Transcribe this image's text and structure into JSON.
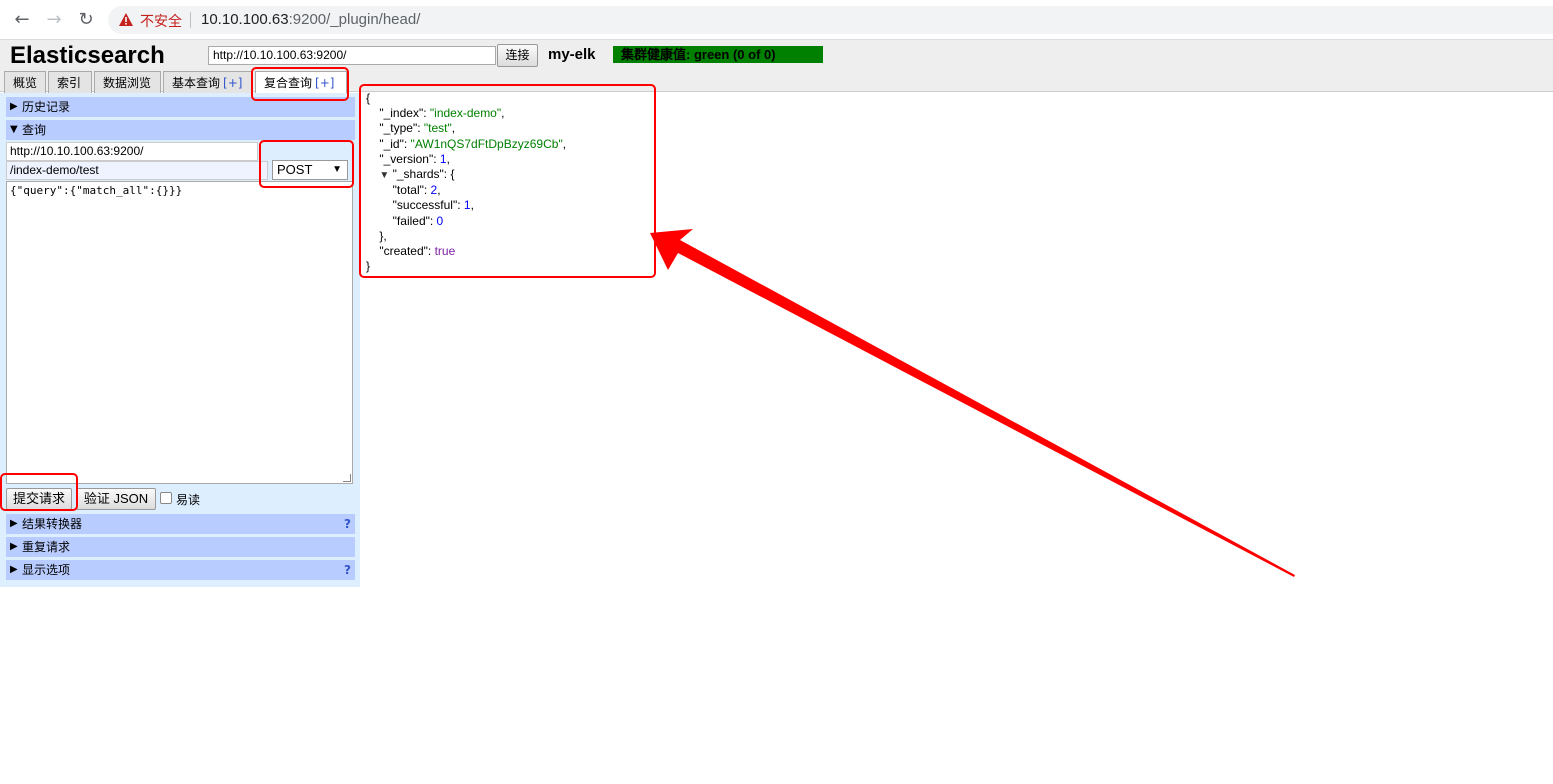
{
  "browser": {
    "security_label": "不安全",
    "url_host": "10.10.100.63",
    "url_rest": ":9200/_plugin/head/"
  },
  "app": {
    "title": "Elasticsearch",
    "connect_url": "http://10.10.100.63:9200/",
    "connect_button": "连接",
    "cluster_name": "my-elk",
    "health_text": "集群健康值: green (0 of 0)",
    "health_color": "#008000"
  },
  "tabs": [
    {
      "label": "概览",
      "plus": ""
    },
    {
      "label": "索引",
      "plus": ""
    },
    {
      "label": "数据浏览",
      "plus": ""
    },
    {
      "label": "基本查询",
      "plus": "[+]"
    },
    {
      "label": "复合查询",
      "plus": "[+]"
    }
  ],
  "left": {
    "history": "历史记录",
    "query": "查询",
    "base_url": "http://10.10.100.63:9200/",
    "path": "/index-demo/test",
    "method": "POST",
    "body": "{\"query\":{\"match_all\":{}}}",
    "submit": "提交请求",
    "validate": "验证 JSON",
    "pretty_label": "易读",
    "transformer": "结果转换器",
    "repeat": "重复请求",
    "display": "显示选项",
    "help": "?"
  },
  "result": {
    "_index": "index-demo",
    "_type": "test",
    "_id": "AW1nQS7dFtDpBzyz69Cb",
    "_version": "1",
    "total": "2",
    "successful": "1",
    "failed": "0",
    "created": "true"
  }
}
